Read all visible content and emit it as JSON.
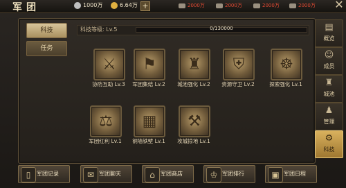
{
  "header": {
    "title": "军团",
    "resources": [
      {
        "icon": "silver-coin-icon",
        "value": "1000万",
        "color": "#c0c0c0"
      },
      {
        "icon": "gold-coin-icon",
        "value": "6.64万",
        "color": "#e0b040"
      }
    ],
    "troops": [
      {
        "icon": "infantry-icon",
        "value": "2000万"
      },
      {
        "icon": "cavalry-icon",
        "value": "2000万"
      },
      {
        "icon": "archer-icon",
        "value": "2000万"
      },
      {
        "icon": "chariot-icon",
        "value": "2000万"
      }
    ]
  },
  "left_tabs": [
    {
      "label": "科技",
      "active": true
    },
    {
      "label": "任务",
      "active": false
    }
  ],
  "tech": {
    "level_label": "科技等级: Lv.5",
    "progress_text": "0/130000",
    "progress_fraction": 0
  },
  "skills": [
    {
      "label": "协防互助 Lv.3",
      "icon": "mutual-defense-icon"
    },
    {
      "label": "军团集结 Lv.2",
      "icon": "rally-icon"
    },
    {
      "label": "城池强化 Lv.2",
      "icon": "city-fortify-icon"
    },
    {
      "label": "资源守卫 Lv.2",
      "icon": "resource-guard-icon"
    },
    {
      "label": "探索强化 Lv.1",
      "icon": "explore-boost-icon"
    },
    {
      "label": "军团红利 Lv.1",
      "icon": "bonus-icon"
    },
    {
      "label": "铜墙铁壁 Lv.1",
      "icon": "iron-wall-icon"
    },
    {
      "label": "攻城掠地 Lv.1",
      "icon": "siege-icon"
    }
  ],
  "right_nav": [
    {
      "label": "概览",
      "icon": "overview-icon",
      "active": false
    },
    {
      "label": "成员",
      "icon": "members-icon",
      "active": false
    },
    {
      "label": "城池",
      "icon": "castle-icon",
      "active": false
    },
    {
      "label": "管理",
      "icon": "manage-icon",
      "active": false
    },
    {
      "label": "科技",
      "icon": "tech-icon",
      "active": true
    }
  ],
  "bottom_buttons": [
    {
      "label": "军团记录",
      "icon": "book-icon"
    },
    {
      "label": "军团聊天",
      "icon": "chat-icon"
    },
    {
      "label": "军团商店",
      "icon": "shop-icon"
    },
    {
      "label": "军团排行",
      "icon": "ranking-icon"
    },
    {
      "label": "军团日程",
      "icon": "calendar-icon"
    }
  ]
}
